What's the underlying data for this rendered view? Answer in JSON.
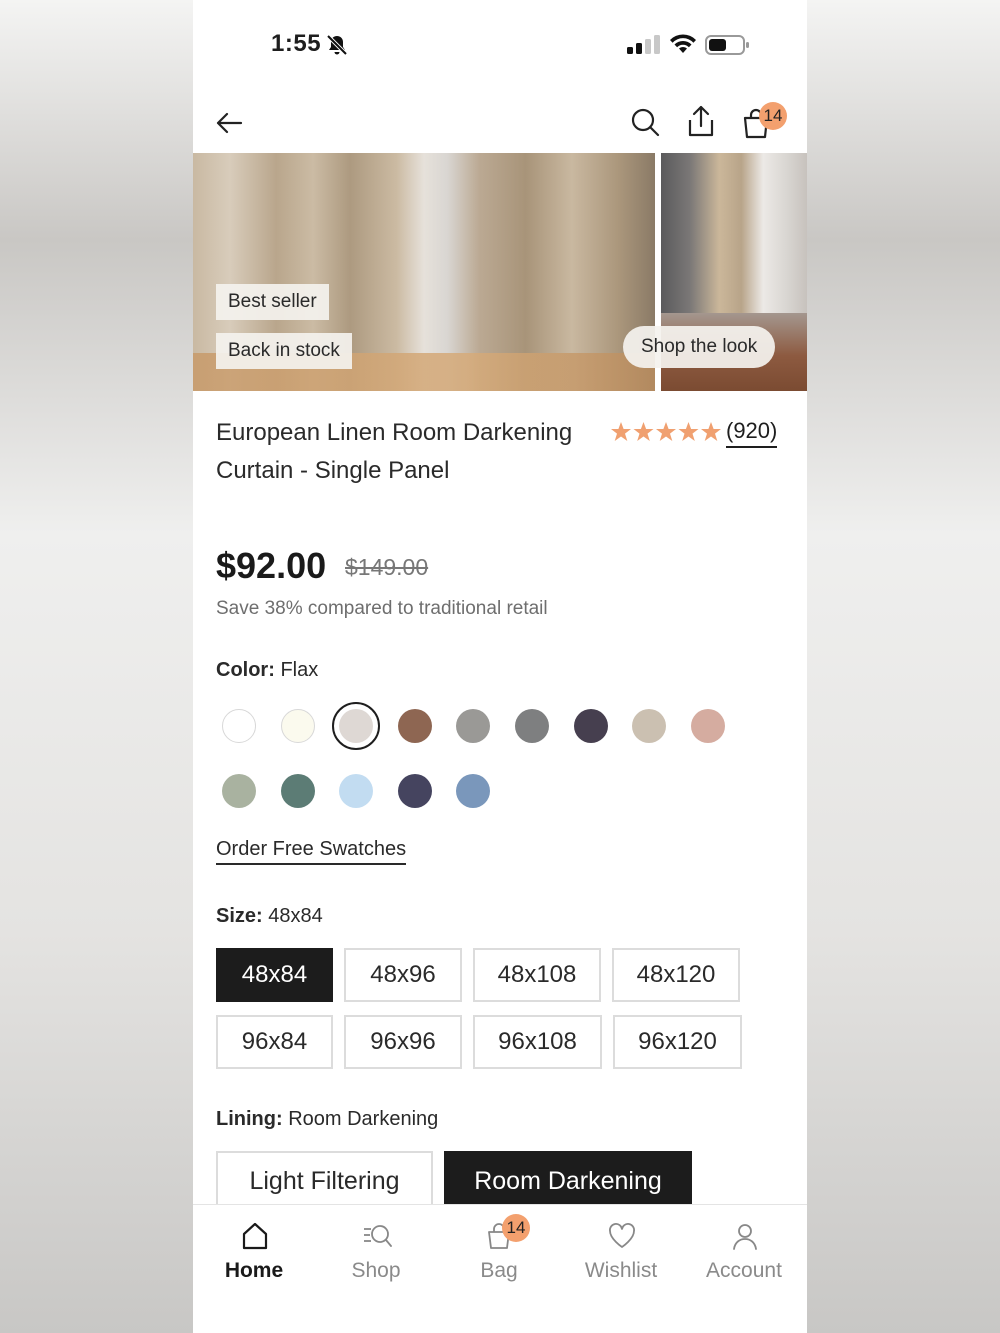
{
  "status_bar": {
    "time": "1:55"
  },
  "header": {
    "bag_count": "14"
  },
  "gallery": {
    "tags": [
      "Best seller",
      "Back in stock"
    ],
    "shop_the_look": "Shop the look"
  },
  "product": {
    "title": "European Linen Room Darkening Curtain - Single Panel",
    "rating": 5,
    "review_count": "(920)",
    "price": "$92.00",
    "original_price": "$149.00",
    "savings_text": "Save 38% compared to traditional retail"
  },
  "color": {
    "label": "Color:",
    "selected": "Flax",
    "swatches": [
      "#ffffff",
      "#fbfaee",
      "#ded8d4",
      "#8e6652",
      "#9a9996",
      "#7e7f80",
      "#463f4f",
      "#cbc0b1",
      "#d5aca0",
      "#a9b2a0",
      "#5c7c75",
      "#c2dcf1",
      "#45445f",
      "#7a97bb"
    ],
    "selected_index": 2,
    "order_swatches": "Order Free Swatches"
  },
  "size": {
    "label": "Size:",
    "selected": "48x84",
    "options": [
      "48x84",
      "48x96",
      "48x108",
      "48x120",
      "96x84",
      "96x96",
      "96x108",
      "96x120"
    ]
  },
  "lining": {
    "label": "Lining:",
    "selected": "Room Darkening",
    "options": [
      "Light Filtering",
      "Room Darkening"
    ]
  },
  "tabbar": {
    "items": [
      "Home",
      "Shop",
      "Bag",
      "Wishlist",
      "Account"
    ],
    "active": "Home",
    "bag_count": "14"
  },
  "colors": {
    "accent": "#f3a06e",
    "selected_bg": "#1c1c1c",
    "star": "#f0a070"
  }
}
